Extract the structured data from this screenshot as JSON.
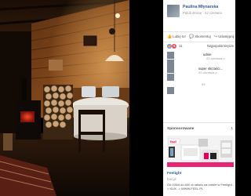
{
  "post": {
    "author": "Paulina Młynarska",
    "page_link": "Polub stronę",
    "separator": "·",
    "time": "22 czerwca",
    "action_like": "Lubię to!",
    "action_comment": "Skomentuj",
    "action_share": "Udostępnij",
    "reaction_count": "11",
    "sort_label": "Najpopularniejsze"
  },
  "comments": [
    {
      "name": "",
      "text": "udnie",
      "time": "22 czerwca o",
      "count": ""
    },
    {
      "name": "",
      "text": "",
      "time": "",
      "count": ""
    },
    {
      "name": "",
      "text": "super skrzaści...",
      "time": "22 czerwca o",
      "count": ""
    },
    {
      "name": "",
      "text": "",
      "time": "",
      "count": ""
    },
    {
      "name": "",
      "text": "",
      "time": "",
      "count": "93"
    },
    {
      "name": "",
      "text": "",
      "time": "",
      "count": ""
    }
  ],
  "sponsored": {
    "title": "Sponsorowane",
    "more": "1",
    "ad_title": "Feelight",
    "ad_url": "feel.pl",
    "ad_desc": "Od 100zł do 600 zł rabatu na meble w Feelight -> KLIK -> WWW.FEEL.PL",
    "ad_brand": "feel"
  },
  "icons": {
    "like": "thumbs-up-icon",
    "comment": "comment-icon",
    "share": "share-icon",
    "like_reaction": "like-reaction-icon",
    "love_reaction": "love-reaction-icon"
  },
  "colors": {
    "link": "#365899",
    "muted": "#90949c",
    "like_blue": "#5890ff",
    "love_red": "#f25268"
  }
}
